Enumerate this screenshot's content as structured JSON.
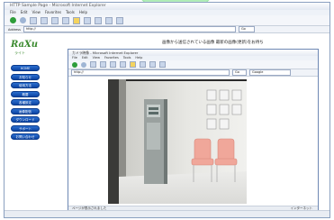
{
  "outer_window": {
    "title": "HTTP Sample Page - Microsoft Internet Explorer",
    "menu": [
      "File",
      "Edit",
      "View",
      "Favorites",
      "Tools",
      "Help"
    ],
    "address_label": "Address",
    "address_url": "http://",
    "go_label": "Go"
  },
  "page": {
    "logo": "RaXu",
    "logo_sub": "ライト",
    "logo_sub2": "",
    "caption": "画像から送信されている画像 最新の画像(更新)をお待ち",
    "nav_items": [
      "HOME",
      "お知らせ",
      "使用方法",
      "概要",
      "各種設定",
      "画像配信",
      "ダウンロード",
      "サポート",
      "お問い合わせ"
    ]
  },
  "inner_window": {
    "title": "カメラ映像 - Microsoft Internet Explorer",
    "menu": [
      "File",
      "Edit",
      "View",
      "Favorites",
      "Tools",
      "Help"
    ],
    "address_url": "http://",
    "go_label": "Go",
    "search_label": "Google",
    "status_left": "ページが表示されました",
    "status_right": "インターネット"
  },
  "colors": {
    "nav_blue": "#1558b8",
    "logo_green": "#3a8a2e",
    "arrow_green": "#b9f2c0"
  },
  "icons": [
    "back-icon",
    "forward-icon",
    "stop-icon",
    "refresh-icon",
    "home-icon",
    "search-icon",
    "favorites-icon",
    "media-icon",
    "history-icon",
    "mail-icon",
    "print-icon"
  ]
}
